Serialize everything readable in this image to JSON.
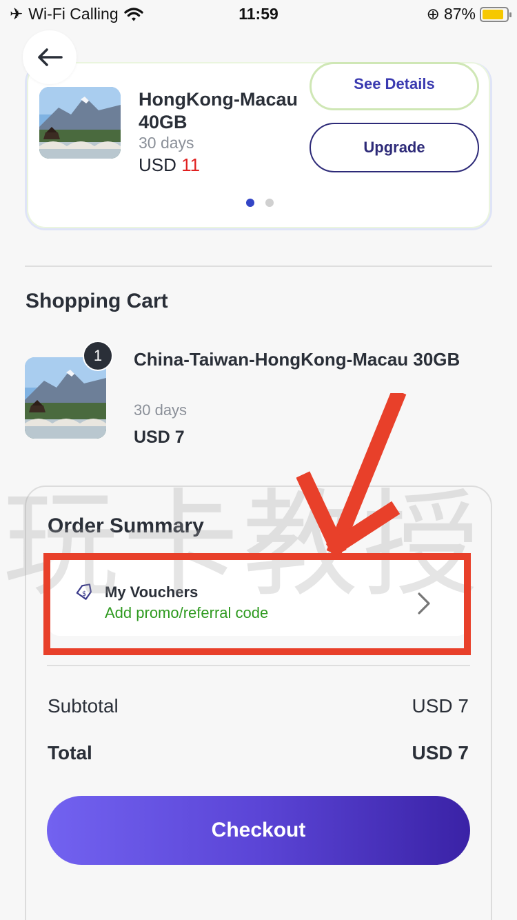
{
  "status_bar": {
    "carrier": "Wi-Fi Calling",
    "time": "11:59",
    "battery": "87%"
  },
  "active_plan": {
    "name": "HongKong-Macau 40GB",
    "duration": "30 days",
    "price_currency": "USD",
    "price_amount": "11",
    "see_details_label": "See Details",
    "upgrade_label": "Upgrade",
    "page_count": 2,
    "active_page": 1
  },
  "cart": {
    "title": "Shopping Cart",
    "items": [
      {
        "quantity": "1",
        "name": "China-Taiwan-HongKong-Macau 30GB",
        "duration": "30 days",
        "price": "USD 7"
      }
    ]
  },
  "order_summary": {
    "title": "Order Summary",
    "voucher_title": "My Vouchers",
    "voucher_subtitle": "Add promo/referral code",
    "subtotal_label": "Subtotal",
    "subtotal_value": "USD 7",
    "total_label": "Total",
    "total_value": "USD 7",
    "checkout_label": "Checkout"
  },
  "overlay": {
    "watermark": "玩卡教授",
    "annotation_color": "#e8402a"
  },
  "colors": {
    "accent_purple": "#5b45d6",
    "price_red": "#e02020",
    "promo_green": "#2e9a1f",
    "dot_active": "#3345c6"
  }
}
